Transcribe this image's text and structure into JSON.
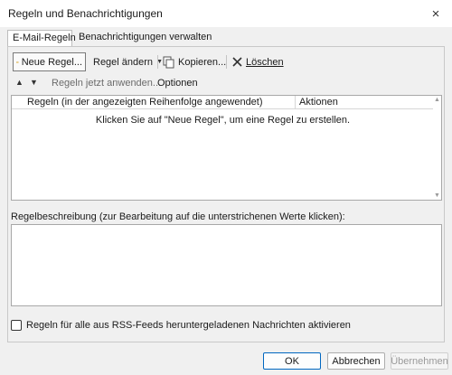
{
  "window": {
    "title": "Regeln und Benachrichtigungen",
    "close_glyph": "×"
  },
  "tabs": [
    {
      "label": "E-Mail-Regeln",
      "active": true
    },
    {
      "label": "Benachrichtigungen verwalten",
      "active": false
    }
  ],
  "toolbar": {
    "new_rule": "Neue Regel...",
    "change_rule": "Regel ändern",
    "copy": "Kopieren...",
    "delete": "Löschen"
  },
  "row2": {
    "move_up_glyph": "▲",
    "move_down_glyph": "▼",
    "run_rules": "Regeln jetzt anwenden...",
    "options": "Optionen"
  },
  "rules_list": {
    "columns": [
      "Regeln (in der angezeigten Reihenfolge angewendet)",
      "Aktionen"
    ],
    "empty_message": "Klicken Sie auf \"Neue Regel\", um eine Regel zu erstellen.",
    "rows": []
  },
  "description": {
    "label": "Regelbeschreibung (zur Bearbeitung auf die unterstrichenen Werte klicken):",
    "text": ""
  },
  "rss_checkbox": {
    "label": "Regeln für alle aus RSS-Feeds heruntergeladenen Nachrichten aktivieren",
    "checked": false
  },
  "buttons": {
    "ok": "OK",
    "cancel": "Abbrechen",
    "apply": "Übernehmen"
  },
  "icons": {
    "new_rule": "new-rule-icon",
    "copy": "copy-icon",
    "delete": "delete-x-icon"
  },
  "colors": {
    "ok_border": "#0067c0",
    "delete_icon": "#333333"
  }
}
